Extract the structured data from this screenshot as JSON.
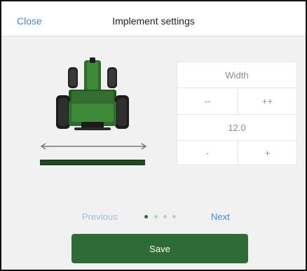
{
  "header": {
    "close_label": "Close",
    "title": "Implement settings"
  },
  "width_panel": {
    "heading": "Width",
    "big_decrement_label": "--",
    "big_increment_label": "++",
    "value": "12.0",
    "small_decrement_label": "-",
    "small_increment_label": "+"
  },
  "pager": {
    "previous_label": "Previous",
    "next_label": "Next",
    "page_count": 4,
    "current_page": 1
  },
  "footer": {
    "save_label": "Save"
  },
  "colors": {
    "accent_link": "#3c8fd6",
    "save_button": "#2f6b36",
    "tractor_body": "#2f6b2c",
    "implement_bar": "#1f4a22",
    "dot_active": "#2f6b36",
    "dot_inactive": "#b8d4b9"
  },
  "icons": {
    "tractor": "tractor-rear-view-icon",
    "width_arrow": "double-arrow-icon"
  }
}
